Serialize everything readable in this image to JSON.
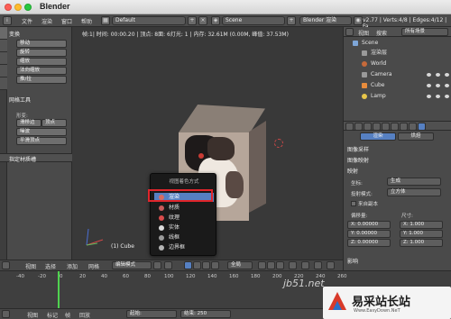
{
  "window": {
    "title": "Blender"
  },
  "info_header": {
    "menus": [
      "文件",
      "渲染",
      "窗口",
      "帮助"
    ],
    "layout": "Default",
    "scene": "Scene",
    "engine": "Blender 渲染",
    "stats": "v2.77 | Verts:4/8 | Edges:4/12 | Fa"
  },
  "tool_shelf": {
    "section1": "变换",
    "buttons1": [
      "移动",
      "旋转",
      "缩放",
      "法向缩放",
      "推/拉"
    ],
    "section2": "网格工具",
    "sub_deform": "形变:",
    "deform_left": "滑移边",
    "deform_right": "顶点",
    "buttons2": [
      "噪波",
      "平滑顶点"
    ],
    "last_op": "指定材质槽"
  },
  "viewport": {
    "info": "帧:1| 时间: 00:00.20 | 顶点: 8面: 6灯光: 1 | 内存: 32.61M (0.00M, 峰值: 37.53M)",
    "object_label": "(1) Cube"
  },
  "shading_menu": {
    "title": "视图着色方式",
    "items": [
      {
        "label": "渲染",
        "color": "#d86b61",
        "selected": true
      },
      {
        "label": "材质",
        "color": "#c85b5b",
        "selected": false
      },
      {
        "label": "纹理",
        "color": "#d94c4c",
        "selected": false
      },
      {
        "label": "实体",
        "color": "#dddddd",
        "selected": false
      },
      {
        "label": "线框",
        "color": "#9a9a9a",
        "selected": false
      },
      {
        "label": "边界框",
        "color": "#b5b5b5",
        "selected": false
      }
    ]
  },
  "view3d_header": {
    "menus": [
      "视图",
      "选择",
      "添加",
      "网格"
    ],
    "mode": "编辑模式",
    "pivot": "全局"
  },
  "outliner": {
    "tabs": [
      "视图",
      "搜索",
      "所有场景"
    ],
    "rows": [
      {
        "label": "Scene",
        "indent": 0,
        "color": "#7ea6d8"
      },
      {
        "label": "渲染层",
        "indent": 1,
        "color": "#9a9a9a"
      },
      {
        "label": "World",
        "indent": 1,
        "color": "#c66a3a"
      },
      {
        "label": "Camera",
        "indent": 1,
        "color": "#9a9a9a"
      },
      {
        "label": "Cube",
        "indent": 1,
        "color": "#e88c3c"
      },
      {
        "label": "Lamp",
        "indent": 1,
        "color": "#e8c64a"
      }
    ]
  },
  "properties": {
    "tabs": [
      "渲染",
      "烘焙"
    ],
    "sections": [
      "图像采样",
      "图像映射"
    ],
    "mapping_section": "映射",
    "fields": [
      {
        "label": "坐标:",
        "value": "生成"
      },
      {
        "label": "投射模式:",
        "value": "立方体"
      }
    ],
    "checkbox": "来自副本",
    "offset_label": "偏移量:",
    "size_label": "尺寸:",
    "offset": [
      "X: 0.00000",
      "Y: 0.00000",
      "Z: 0.00000"
    ],
    "size": [
      "X: 1.000",
      "Y: 1.000",
      "Z: 1.000"
    ],
    "influence": "影响"
  },
  "timeline": {
    "ticks": [
      "-40",
      "-20",
      "0",
      "20",
      "40",
      "60",
      "80",
      "100",
      "120",
      "140",
      "160",
      "180",
      "200",
      "220",
      "240",
      "260"
    ],
    "menus": [
      "视图",
      "标记",
      "帧",
      "回放"
    ],
    "start": "起始:",
    "end": "结束: 250"
  },
  "watermark": {
    "url": "jb51.net",
    "brand": "易采站长站",
    "sub": "Www.EasyDown.NeT"
  }
}
